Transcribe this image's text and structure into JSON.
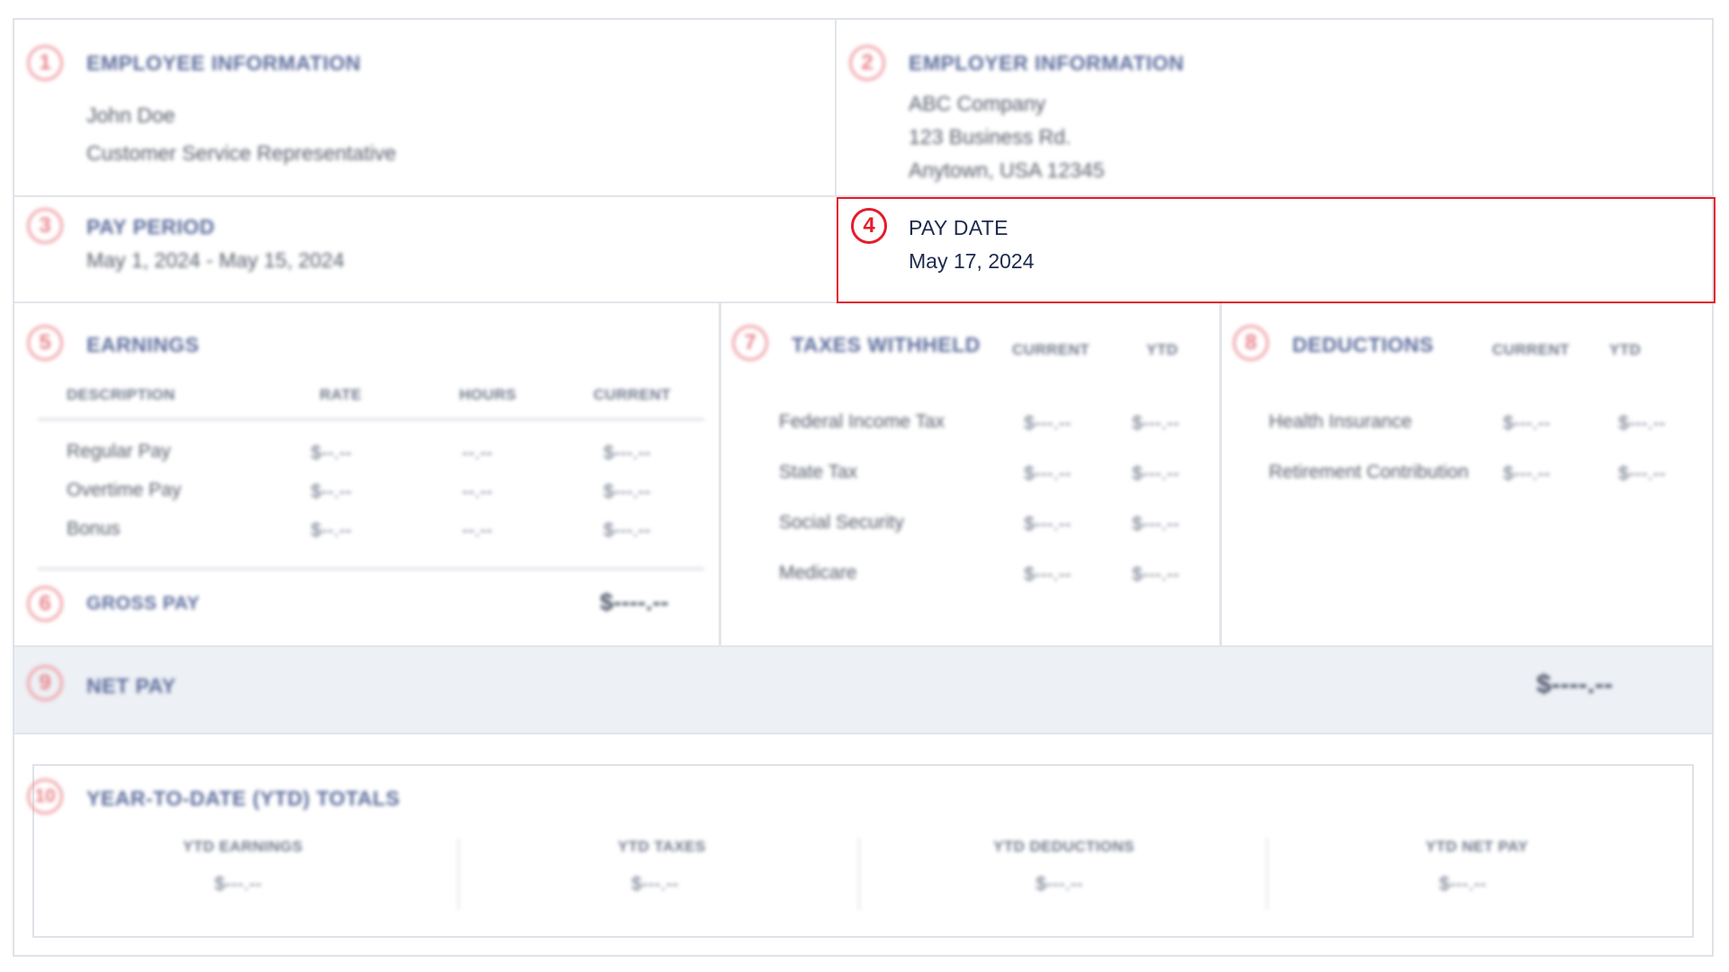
{
  "employee": {
    "number": "1",
    "title": "EMPLOYEE INFORMATION",
    "name": "John Doe",
    "role": "Customer Service Representative"
  },
  "employer": {
    "number": "2",
    "title": "EMPLOYER INFORMATION",
    "company": "ABC Company",
    "street": "123 Business Rd.",
    "city": "Anytown, USA 12345"
  },
  "pay_period": {
    "number": "3",
    "title": "PAY PERIOD",
    "value": "May 1, 2024 - May 15, 2024"
  },
  "pay_date": {
    "number": "4",
    "title": "PAY DATE",
    "value": "May 17, 2024",
    "highlight_color": "#e41c2b"
  },
  "earnings": {
    "number": "5",
    "title": "EARNINGS",
    "columns": [
      "DESCRIPTION",
      "RATE",
      "HOURS",
      "CURRENT"
    ],
    "rows": [
      {
        "description": "Regular Pay",
        "rate": "$--.--",
        "hours": "--.--",
        "current": "$---.--"
      },
      {
        "description": "Overtime Pay",
        "rate": "$--.--",
        "hours": "--.--",
        "current": "$---.--"
      },
      {
        "description": "Bonus",
        "rate": "$--.--",
        "hours": "--.--",
        "current": "$---.--"
      }
    ]
  },
  "gross_pay": {
    "number": "6",
    "title": "GROSS PAY",
    "value": "$----.--"
  },
  "taxes": {
    "number": "7",
    "title": "TAXES WITHHELD",
    "columns": [
      "CURRENT",
      "YTD"
    ],
    "rows": [
      {
        "name": "Federal Income Tax",
        "current": "$---.--",
        "ytd": "$---.--"
      },
      {
        "name": "State Tax",
        "current": "$---.--",
        "ytd": "$---.--"
      },
      {
        "name": "Social Security",
        "current": "$---.--",
        "ytd": "$---.--"
      },
      {
        "name": "Medicare",
        "current": "$---.--",
        "ytd": "$---.--"
      }
    ]
  },
  "deductions": {
    "number": "8",
    "title": "DEDUCTIONS",
    "columns": [
      "CURRENT",
      "YTD"
    ],
    "rows": [
      {
        "name": "Health Insurance",
        "current": "$---.--",
        "ytd": "$---.--"
      },
      {
        "name": "Retirement Contribution",
        "current": "$---.--",
        "ytd": "$---.--"
      }
    ]
  },
  "net_pay": {
    "number": "9",
    "title": "NET PAY",
    "value": "$----.--",
    "band_color": "#edf0f5"
  },
  "ytd": {
    "number": "10",
    "title": "YEAR-TO-DATE (YTD) TOTALS",
    "items": [
      {
        "label": "YTD EARNINGS",
        "value": "$---.--"
      },
      {
        "label": "YTD TAXES",
        "value": "$---.--"
      },
      {
        "label": "YTD DEDUCTIONS",
        "value": "$---.--"
      },
      {
        "label": "YTD NET PAY",
        "value": "$---.--"
      }
    ]
  }
}
